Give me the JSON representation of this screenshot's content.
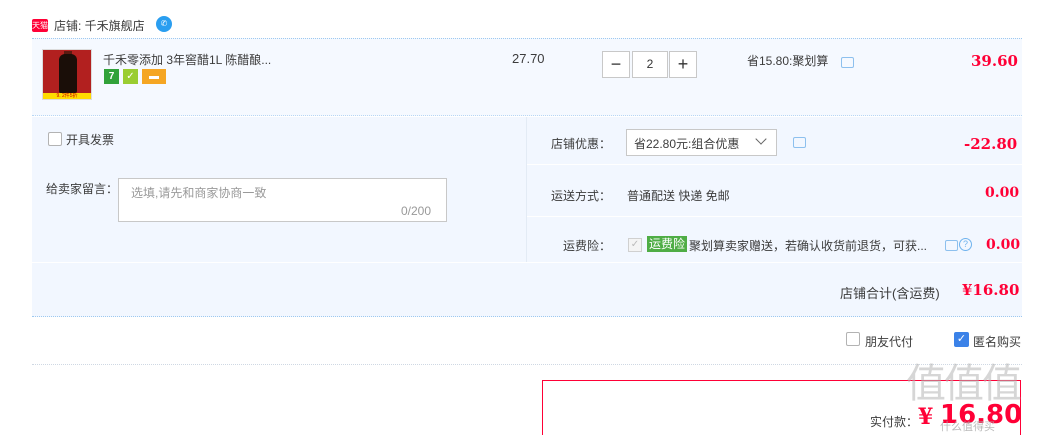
{
  "shop": {
    "badge": "天猫",
    "name": "店铺: 千禾旗舰店",
    "wangwang_icon": "wangwang-chat-icon"
  },
  "item": {
    "thumb_banner": "9.  2件5折",
    "title": "千禾零添加 3年窖醋1L 陈醋酿...",
    "service_icons": [
      "seven-day-return-icon",
      "quality-guarantee-icon",
      "card-payment-icon"
    ],
    "service_badge_1": "7",
    "service_badge_2": "✓",
    "unit_price": "27.70",
    "quantity": {
      "minus": "−",
      "value": "2",
      "plus": "+"
    },
    "promotion": "省15.80:聚划算",
    "total": "39.60"
  },
  "options": {
    "invoice_label": "开具发票",
    "memo_label": "给卖家留言：",
    "memo_placeholder": "选填,请先和商家协商一致",
    "memo_count": "0/200",
    "discount_label": "店铺优惠：",
    "discount_selected": "省22.80元:组合优惠",
    "discount_amount": "-22.80",
    "shipping_label": "运送方式：",
    "shipping_value": "普通配送 快递 免邮",
    "shipping_amount": "0.00",
    "insurance_label": "运费险：",
    "insurance_badge": "运费险",
    "insurance_text": "聚划算卖家赠送，若确认收货前退货，可获...",
    "insurance_amount": "0.00",
    "insurance_check": "✓",
    "help_mark": "?"
  },
  "summary": {
    "label": "店铺合计(含运费)",
    "amount": "¥16.80"
  },
  "checkout": {
    "friend_pay_label": "朋友代付",
    "anonymous_label": "匿名购买",
    "anonymous_check": "✓",
    "pay_label": "实付款：",
    "pay_currency": "¥",
    "pay_amount": "16.80"
  },
  "watermark": {
    "text": "值值值",
    "sub": "什么值得买"
  },
  "colors": {
    "accent_red": "#ff0036",
    "row_bg": "#f5f9ff",
    "option_bg": "#f2f7ff",
    "check_blue": "#3b82e8",
    "insurance_green": "#4fad45"
  }
}
